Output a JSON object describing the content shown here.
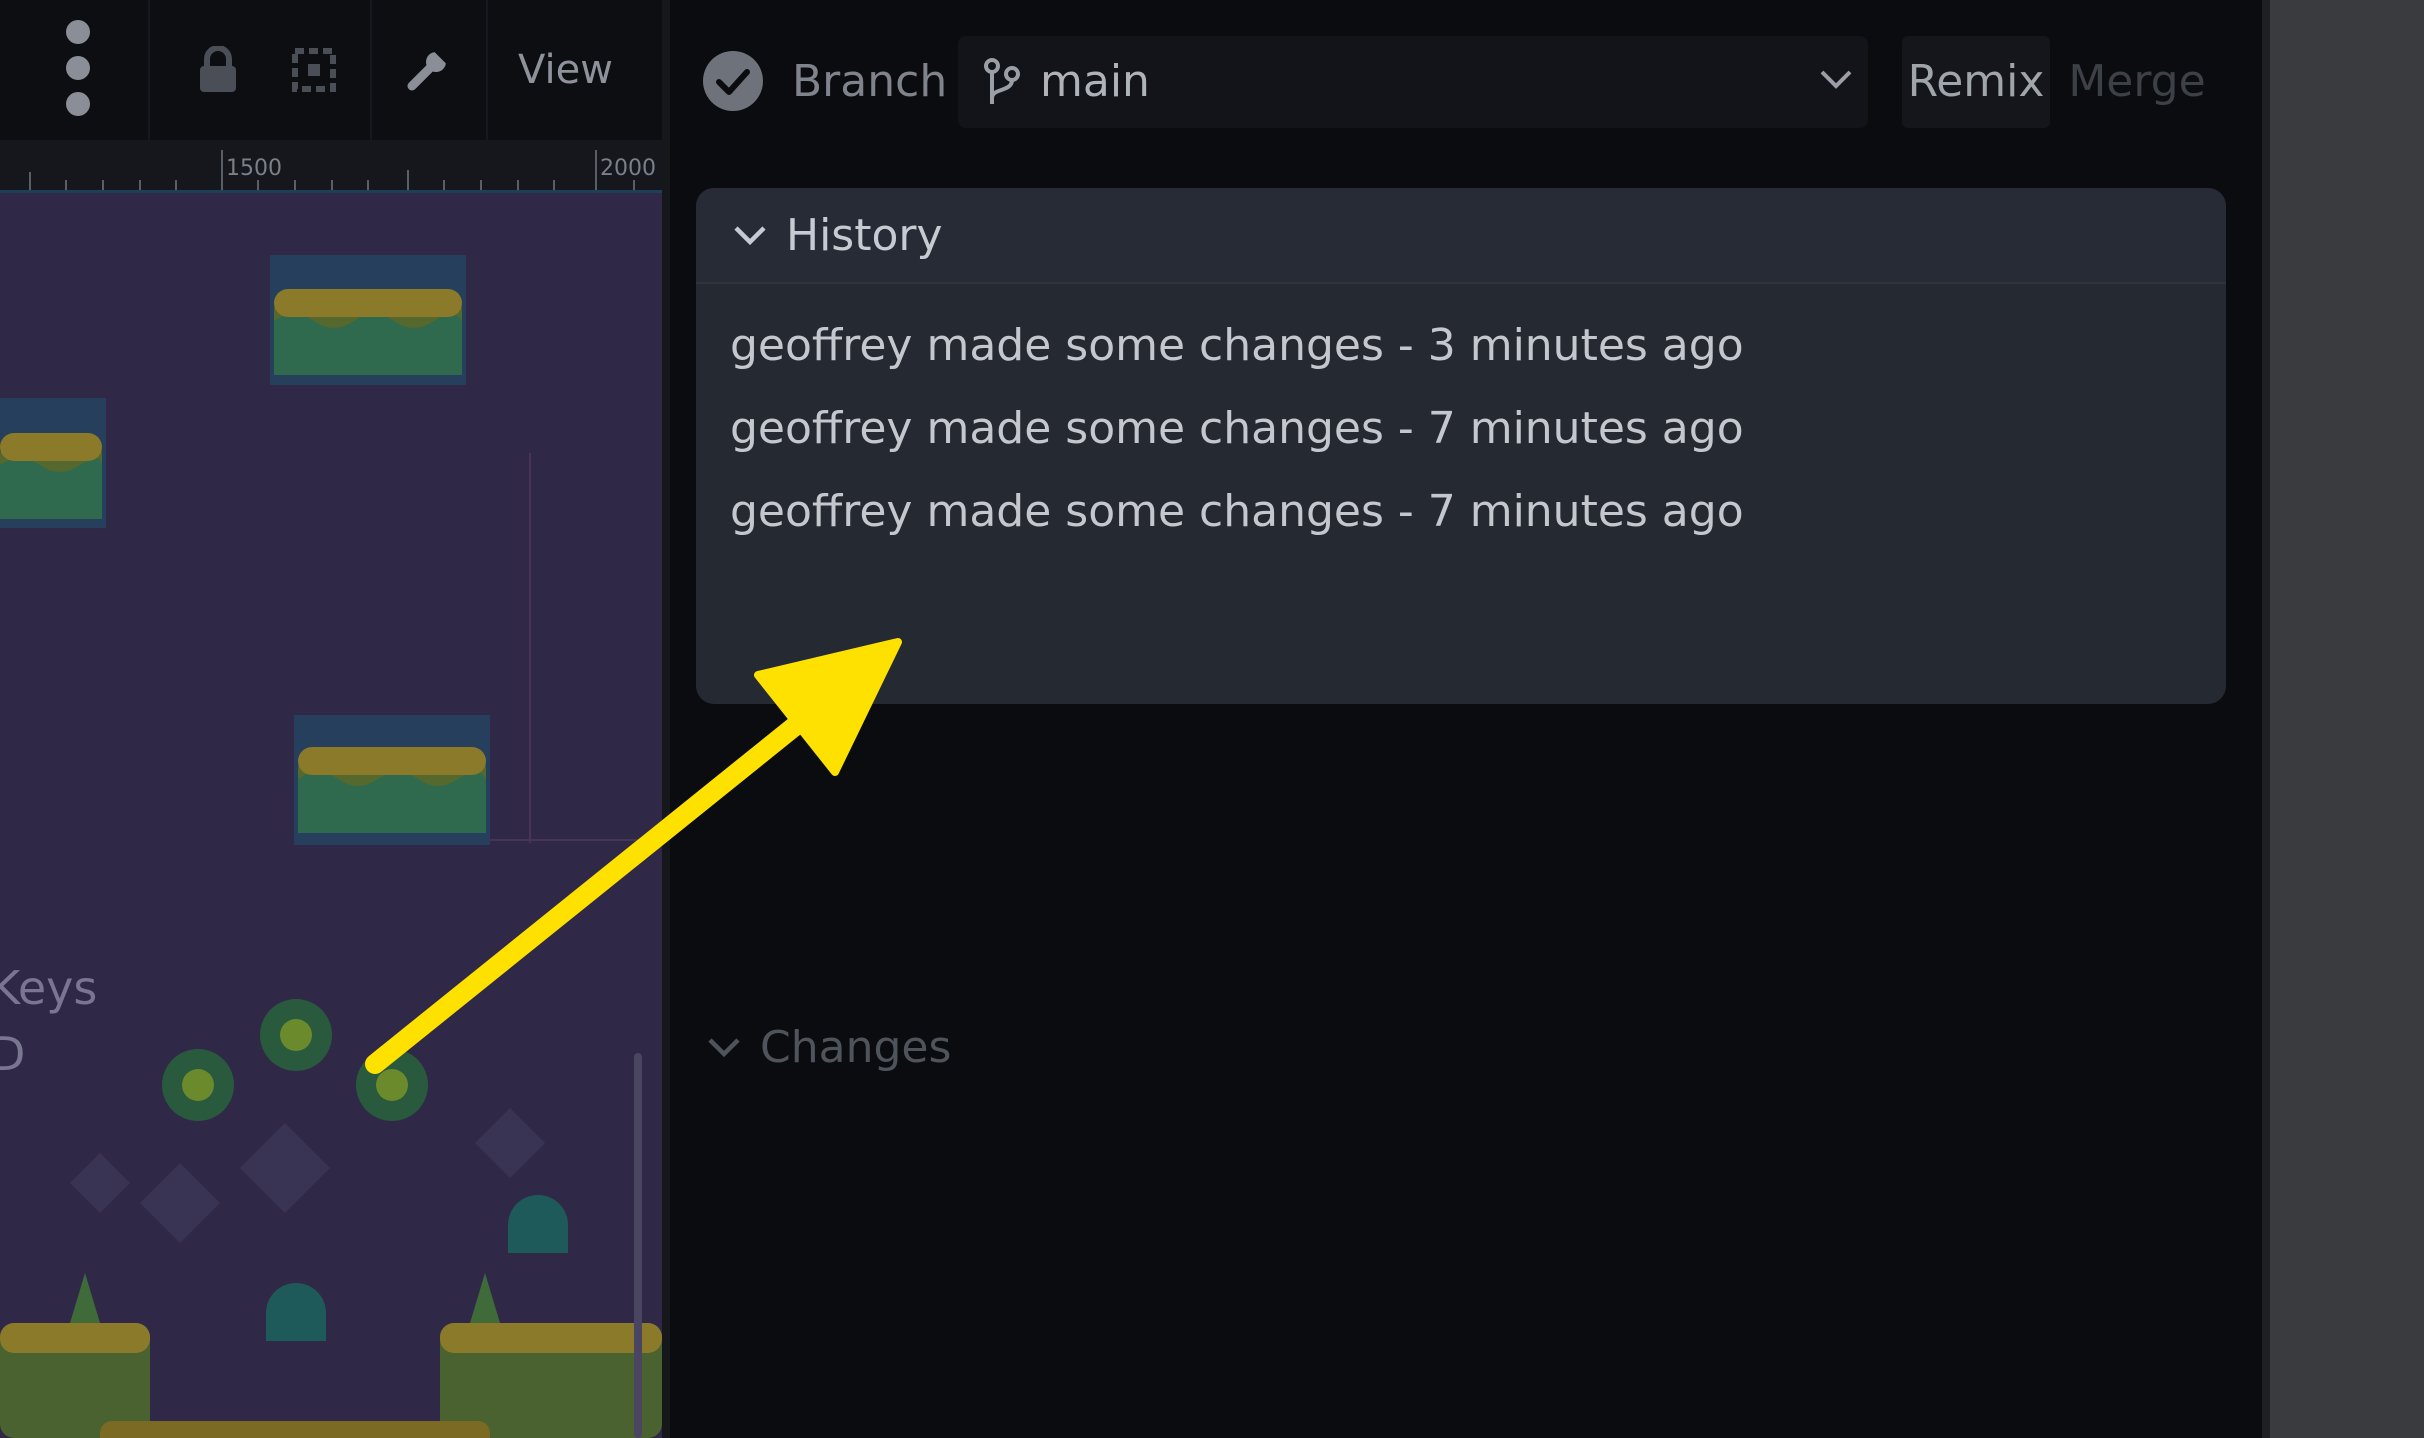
{
  "editor": {
    "toolbar": {
      "view_label": "View"
    },
    "ruler": {
      "labels": [
        "1500",
        "2000"
      ]
    },
    "canvas_text": {
      "line1": "Keys",
      "line2": "D"
    }
  },
  "header": {
    "branch_label": "Branch",
    "branch_value": "main",
    "remix_label": "Remix",
    "merge_label": "Merge"
  },
  "history": {
    "title": "History",
    "entries": [
      "geoffrey made some changes - 3 minutes ago",
      "geoffrey made some changes - 7 minutes ago",
      "geoffrey made some changes - 7 minutes ago"
    ]
  },
  "changes": {
    "title": "Changes"
  },
  "icons": [
    "more-vertical-icon",
    "lock-icon",
    "select-icon",
    "wrench-icon",
    "check-circle-icon",
    "git-branch-icon",
    "chevron-down-icon"
  ],
  "colors": {
    "annotation_arrow": "#ffe100",
    "panel_bg": "#0b0c0f",
    "history_bg": "#242932",
    "canvas_bg": "#2f2947"
  }
}
